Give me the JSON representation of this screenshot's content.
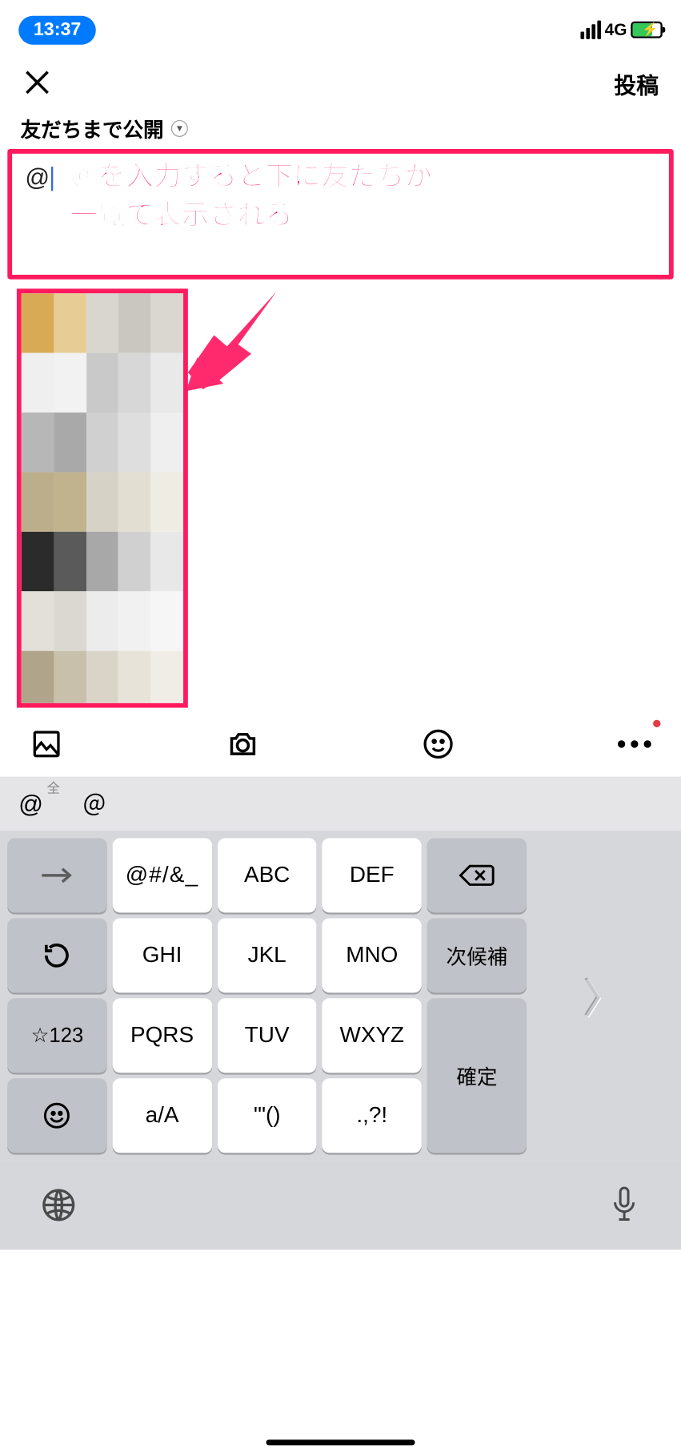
{
  "status": {
    "time": "13:37",
    "network": "4G"
  },
  "header": {
    "post_label": "投稿"
  },
  "privacy": {
    "label": "友だちまで公開"
  },
  "input": {
    "value": "@"
  },
  "annotation": {
    "line1": "＠を入力すると下に友だちが",
    "line2": "一覧で表示される"
  },
  "toolbar": {
    "gallery_icon": "gallery-icon",
    "camera_icon": "camera-icon",
    "smile_icon": "smile-icon",
    "more_icon": "more-icon"
  },
  "candidates": {
    "c1": "@",
    "c1_sup": "全",
    "c2": "＠"
  },
  "keyboard": {
    "r1": {
      "k2": "@#/&_",
      "k3": "ABC",
      "k4": "DEF"
    },
    "r2": {
      "k2": "GHI",
      "k3": "JKL",
      "k4": "MNO",
      "k5": "次候補"
    },
    "r3": {
      "k1": "☆123",
      "k2": "PQRS",
      "k3": "TUV",
      "k4": "WXYZ",
      "k5": "確定"
    },
    "r4": {
      "k2": "a/A",
      "k3": "'\"()",
      "k4": ".,?!"
    }
  }
}
